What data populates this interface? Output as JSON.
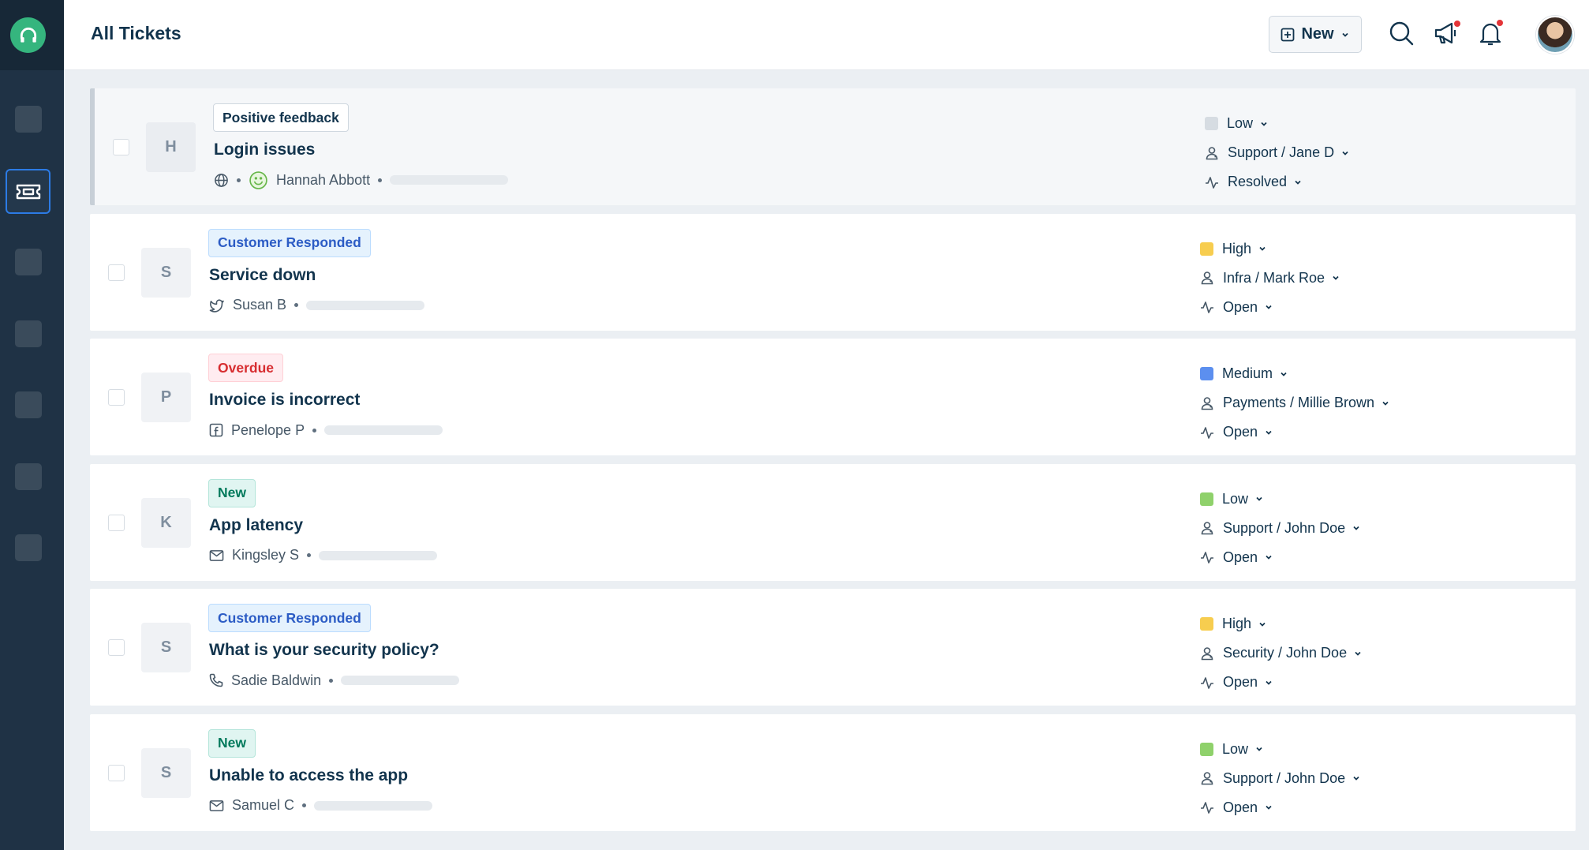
{
  "header": {
    "title": "All Tickets",
    "new_button_label": "New"
  },
  "colors": {
    "brand_green": "#35b57e",
    "sidebar_bg": "#1f3245",
    "priority_low": "#cfd7df",
    "priority_low_green": "#8fd16b",
    "priority_high": "#f7cd4f",
    "priority_medium": "#5c8fef"
  },
  "tickets": [
    {
      "initial": "H",
      "badge": "Positive feedback",
      "badge_style": "neutral",
      "subject": "Login issues",
      "source_icon": "globe-icon",
      "requester": "Hannah Abbott",
      "sentiment_icon": "happy-face-icon",
      "priority": "Low",
      "priority_color": "#d6dce2",
      "assignee": "Support / Jane D",
      "status": "Resolved",
      "selected": true
    },
    {
      "initial": "S",
      "badge": "Customer Responded",
      "badge_style": "blue",
      "subject": "Service down",
      "source_icon": "twitter-icon",
      "requester": "Susan B",
      "priority": "High",
      "priority_color": "#f7cd4f",
      "assignee": "Infra / Mark Roe",
      "status": "Open"
    },
    {
      "initial": "P",
      "badge": "Overdue",
      "badge_style": "red",
      "subject": "Invoice is incorrect",
      "source_icon": "facebook-icon",
      "requester": "Penelope P",
      "priority": "Medium",
      "priority_color": "#5c8fef",
      "assignee": "Payments / Millie Brown",
      "status": "Open"
    },
    {
      "initial": "K",
      "badge": "New",
      "badge_style": "green",
      "subject": "App latency",
      "source_icon": "email-icon",
      "requester": "Kingsley S",
      "priority": "Low",
      "priority_color": "#8fd16b",
      "assignee": "Support / John Doe",
      "status": "Open"
    },
    {
      "initial": "S",
      "badge": "Customer Responded",
      "badge_style": "blue",
      "subject": "What is your security policy?",
      "source_icon": "phone-icon",
      "requester": "Sadie Baldwin",
      "priority": "High",
      "priority_color": "#f7cd4f",
      "assignee": "Security / John Doe",
      "status": "Open"
    },
    {
      "initial": "S",
      "badge": "New",
      "badge_style": "green",
      "subject": "Unable to access the app",
      "source_icon": "email-icon",
      "requester": "Samuel C",
      "priority": "Low",
      "priority_color": "#8fd16b",
      "assignee": "Support / John Doe",
      "status": "Open"
    }
  ]
}
